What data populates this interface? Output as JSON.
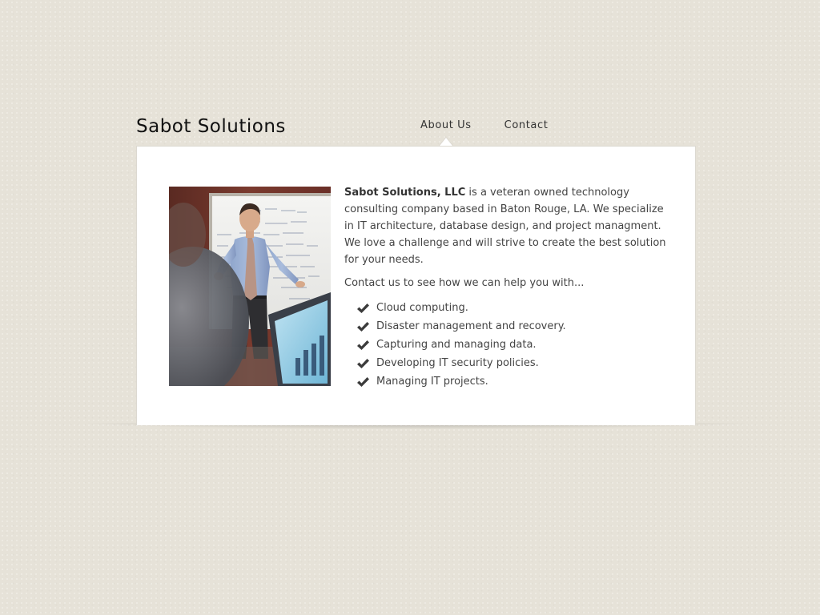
{
  "header": {
    "site_title": "Sabot Solutions"
  },
  "nav": {
    "items": [
      {
        "label": "About Us",
        "active": true
      },
      {
        "label": "Contact",
        "active": false
      }
    ]
  },
  "content": {
    "intro_company": "Sabot Solutions, LLC",
    "intro_text": " is a veteran owned technology consulting company based in Baton Rouge, LA. We specialize in IT architecture, database design, and project managment. We love a challenge and will strive to create the best solution for your needs.",
    "cta_text": "Contact us to see how we can help you with...",
    "services": [
      "Cloud computing.",
      "Disaster management and recovery.",
      "Capturing and managing data.",
      "Developing IT security policies.",
      "Managing IT projects."
    ]
  },
  "icons": {
    "check": "check-icon"
  },
  "colors": {
    "background": "#e6e2d8",
    "panel": "#ffffff",
    "text": "#444444",
    "title": "#111111"
  }
}
